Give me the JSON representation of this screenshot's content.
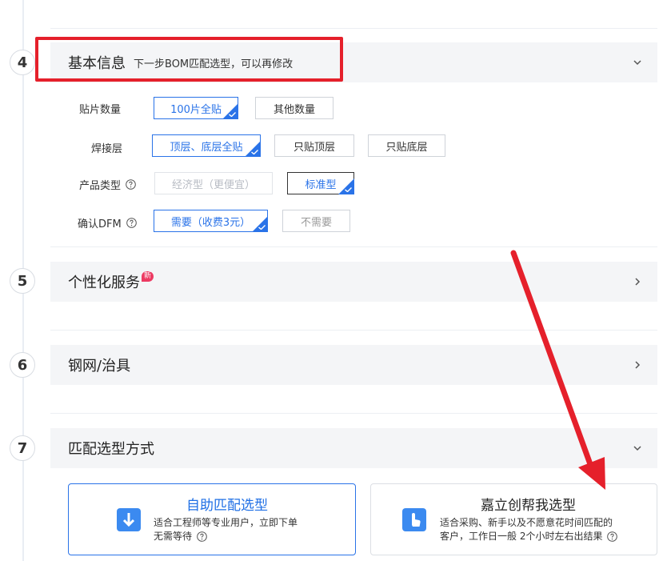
{
  "steps": [
    {
      "number": "4",
      "title": "基本信息",
      "subtitle": "下一步BOM匹配选型，可以再修改"
    },
    {
      "number": "5",
      "title": "个性化服务",
      "badge": "新"
    },
    {
      "number": "6",
      "title": "钢网/治具"
    },
    {
      "number": "7",
      "title": "匹配选型方式"
    }
  ],
  "basic_info": {
    "patch_qty": {
      "label": "贴片数量",
      "options": [
        "100片全贴",
        "其他数量"
      ],
      "selected": "100片全贴"
    },
    "solder_layer": {
      "label": "焊接层",
      "options": [
        "顶层、底层全贴",
        "只贴顶层",
        "只贴底层"
      ],
      "selected": "顶层、底层全贴"
    },
    "product_type": {
      "label": "产品类型",
      "options": [
        "经济型（更便宜）",
        "标准型"
      ],
      "selected": "标准型",
      "disabled": "经济型（更便宜）"
    },
    "dfm": {
      "label": "确认DFM",
      "options": [
        "需要（收费3元）",
        "不需要"
      ],
      "selected": "需要（收费3元）"
    }
  },
  "match_cards": {
    "self": {
      "title": "自助匹配选型",
      "desc_line1": "适合工程师等专业用户，立即下单",
      "desc_line2": "无需等待"
    },
    "assist": {
      "title": "嘉立创帮我选型",
      "desc_line1": "适合采购、新手以及不愿意花时间匹配的",
      "desc_line2": "客户，工作日一般 2个小时左右出结果"
    }
  },
  "colors": {
    "accent": "#2a73e8",
    "annotation_red": "#e5202b",
    "badge": "#ec3a62"
  }
}
